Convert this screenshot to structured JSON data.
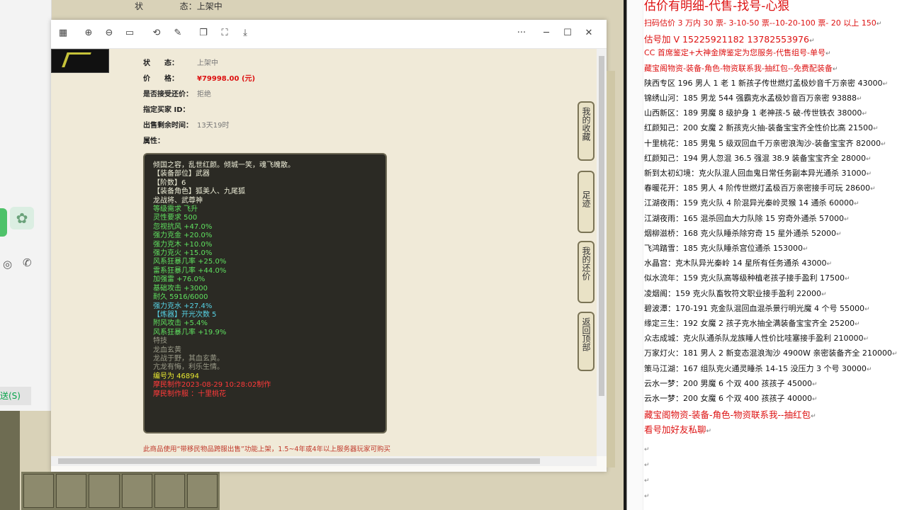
{
  "background": {
    "status_label": "状",
    "status_sep": "态：",
    "status_value": "上架中"
  },
  "chat": {
    "send_label": "送(S)"
  },
  "viewer": {
    "toolbar_more": "···",
    "info": {
      "status_label": "状　　态：",
      "status_value": "上架中",
      "price_label": "价　　格：",
      "price_value": "¥79998.00 (元)",
      "counter_label": "是否接受还价：",
      "counter_value": "拒绝",
      "buyer_label": "指定买家 ID：",
      "buyer_value": "",
      "remaining_label": "出售剩余时间：",
      "remaining_value": "13天19时",
      "attr_label": "属性："
    },
    "attributes": [
      {
        "text": "倾国之容，乱世红颜。倾城一笑，魂飞魄散。",
        "cls": "c-white"
      },
      {
        "text": "【装备部位】武器",
        "cls": "c-white"
      },
      {
        "text": "【阶数】6",
        "cls": "c-white"
      },
      {
        "text": "【装备角色】狐美人、九尾狐",
        "cls": "c-white"
      },
      {
        "text": "龙战将、武尊神",
        "cls": "c-white"
      },
      {
        "text": "等级需求 飞升",
        "cls": "c-green"
      },
      {
        "text": "灵性要求 500",
        "cls": "c-green"
      },
      {
        "text": "忽视抗风 +47.0%",
        "cls": "c-green"
      },
      {
        "text": "强力克金 +20.0%",
        "cls": "c-green"
      },
      {
        "text": "强力克木 +10.0%",
        "cls": "c-green"
      },
      {
        "text": "强力克火 +15.0%",
        "cls": "c-green"
      },
      {
        "text": "风系狂暴几率 +25.0%",
        "cls": "c-green"
      },
      {
        "text": "雷系狂暴几率 +44.0%",
        "cls": "c-green"
      },
      {
        "text": "加强雷 +76.0%",
        "cls": "c-green"
      },
      {
        "text": "基础攻击 +3000",
        "cls": "c-green"
      },
      {
        "text": "耐久 5916/6000",
        "cls": "c-green"
      },
      {
        "text": "强力克水 +27.4%",
        "cls": "c-cyan"
      },
      {
        "text": " ",
        "cls": "c-white"
      },
      {
        "text": "【炼器】开光次数 5",
        "cls": "c-cyan"
      },
      {
        "text": "附风攻击 +5.4%",
        "cls": "c-green"
      },
      {
        "text": "风系狂暴几率 +19.9%",
        "cls": "c-green"
      },
      {
        "text": "特技",
        "cls": "c-gray"
      },
      {
        "text": "龙血玄黄",
        "cls": "c-gray"
      },
      {
        "text": "龙战于野，其血玄黄。",
        "cls": "c-gray"
      },
      {
        "text": "亢龙有悔，利乐生情。",
        "cls": "c-gray"
      },
      {
        "text": " ",
        "cls": "c-white"
      },
      {
        "text": "编号为 46894",
        "cls": "c-yellow"
      },
      {
        "text": "摩民制作2023-08-29 10:28:02制作",
        "cls": "c-red"
      },
      {
        "text": "摩民制作服 ：十里桃花",
        "cls": "c-red"
      }
    ],
    "footer_note": "此商品使用“带移民物品跨服出售”功能上架，1.5~4年或4年以上服务器玩家可购买"
  },
  "side_buttons": [
    {
      "label": "我的收藏"
    },
    {
      "label": "足迹"
    },
    {
      "label": "我的还价"
    },
    {
      "label": "返回顶部"
    }
  ],
  "doc": {
    "title": "估价有明细-代售-找号-心狠",
    "lines": [
      {
        "text": "扫码估价 3 万内 30 票- 3-10-50 票--10-20-100 票- 20 以上 150",
        "cls": "doc-red"
      },
      {
        "text": "估号加 V 15225921182   13782553976",
        "cls": "doc-red-big"
      },
      {
        "text": "CC 首席鉴定+大神金牌鉴定为您服务-代售组号-单号",
        "cls": "doc-red"
      },
      {
        "text": "藏宝阁物资-装备-角色-物资联系我-抽红包--免费配装备",
        "cls": "doc-red"
      },
      {
        "text": "陕西专区 196 男人 1 老 1 新孩子传世燃灯孟极妙音千万亲密 43000",
        "cls": ""
      },
      {
        "text": "锦绣山河：185 男龙 544 强霸克水孟极妙音百万亲密 93888",
        "cls": ""
      },
      {
        "text": "山西新区：189 男魔 8 级护身 1 老神孩-5 破-传世铁衣 38000",
        "cls": ""
      },
      {
        "text": "红颜知己：200 女魔 2 新孩克火抽-装备宝宝齐全性价比高 21500",
        "cls": ""
      },
      {
        "text": "十里桃花：185 男鬼 5 级双回血千万亲密浪淘沙-装备宝宝齐 82000",
        "cls": ""
      },
      {
        "text": "红颜知己：194 男人忽混 36.5 强混 38.9 装备宝宝齐全 28000",
        "cls": ""
      },
      {
        "text": "新到太初幻境：克火队混人回血鬼日常任务副本异光通杀 31000",
        "cls": ""
      },
      {
        "text": "春暖花开：185 男人 4 阶传世燃灯孟极百万亲密接手可玩 28600",
        "cls": ""
      },
      {
        "text": "江湖夜雨：159 克火队 4 阶混异光秦岭灵猴 14 通杀 60000",
        "cls": ""
      },
      {
        "text": "江湖夜雨：165 混杀回血大力队除 15 穷奇外通杀 57000",
        "cls": ""
      },
      {
        "text": "烟柳滋桥：168 克火队睡杀除穷奇 15 星外通杀 52000",
        "cls": ""
      },
      {
        "text": "飞鸿踏雪：185 克火队睡杀宫位通杀 153000",
        "cls": ""
      },
      {
        "text": "水晶宫：克木队异光秦岭 14 星所有任务通杀 43000",
        "cls": ""
      },
      {
        "text": "似水流年：159 克火队高等级种植老孩子接手盈利 17500",
        "cls": ""
      },
      {
        "text": "凌烟阁：159 克火队畜牧符文职业接手盈利 22000",
        "cls": ""
      },
      {
        "text": "碧波潭：170-191 克金队混回血混杀景行明光魔 4 个号 55000",
        "cls": ""
      },
      {
        "text": "缘定三生：192 女魔 2 孩子克水抽全满装备宝宝齐全 25200",
        "cls": ""
      },
      {
        "text": "众志成城：克火队通杀队龙族睡人性价比哇塞接手盈利 210000",
        "cls": ""
      },
      {
        "text": "万家灯火：181 男人 2 新变态混浪淘沙 4900W 亲密装备齐全 210000",
        "cls": ""
      },
      {
        "text": "策马江湖：167 组队克火通灵睡杀 14-15 没压力 3 个号 30000",
        "cls": ""
      },
      {
        "text": "云水一梦：200 男魔 6 个双 400 孩孩子 45000",
        "cls": ""
      },
      {
        "text": "云水一梦：200 女魔 6 个双 400 孩孩子 40000",
        "cls": ""
      },
      {
        "text": "藏宝阁物资-装备-角色-物资联系我--抽红包",
        "cls": "doc-red-big"
      },
      {
        "text": "看号加好友私聊",
        "cls": "doc-red-big"
      }
    ],
    "para_mark": "↵"
  }
}
